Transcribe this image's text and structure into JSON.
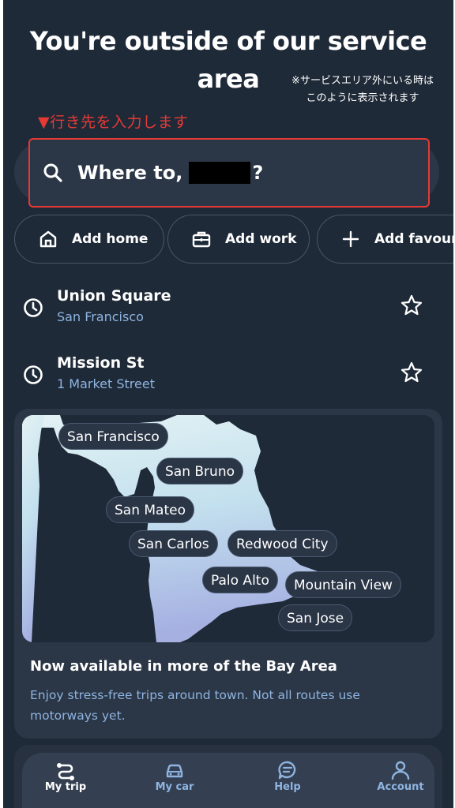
{
  "header": {
    "title_line1": "You're outside of our service",
    "title_line2": "area"
  },
  "annotations": {
    "note_line1": "※サービスエリア外にいる時は",
    "note_line2": "このように表示されます",
    "instruction": "▼行き先を入力します",
    "highlight_color": "#e53935"
  },
  "search": {
    "prefix": "Where to,",
    "suffix": "?",
    "icon": "search-icon"
  },
  "quick_actions": [
    {
      "label": "Add home",
      "icon": "home-icon"
    },
    {
      "label": "Add work",
      "icon": "briefcase-icon"
    },
    {
      "label": "Add favourit",
      "icon": "plus-icon"
    }
  ],
  "recent_places": [
    {
      "title": "Union Square",
      "subtitle": "San Francisco"
    },
    {
      "title": "Mission St",
      "subtitle": "1 Market Street"
    }
  ],
  "service_card": {
    "cities": [
      "San Francisco",
      "San Bruno",
      "San Mateo",
      "San Carlos",
      "Redwood City",
      "Palo Alto",
      "Mountain View",
      "San Jose"
    ],
    "title": "Now available in more of the Bay Area",
    "body": "Enjoy stress-free trips around town. Not all routes use motorways yet."
  },
  "tabbar": {
    "tabs": [
      {
        "label": "My trip",
        "icon": "route-icon",
        "active": true
      },
      {
        "label": "My car",
        "icon": "car-icon",
        "active": false
      },
      {
        "label": "Help",
        "icon": "chat-icon",
        "active": false
      },
      {
        "label": "Account",
        "icon": "person-icon",
        "active": false
      }
    ]
  },
  "colors": {
    "background": "#1f2a38",
    "surface": "#2b3646",
    "accent_text": "#8fb4e0",
    "map_water_start": "#dff0f4",
    "map_water_end": "#a8b4e4"
  }
}
